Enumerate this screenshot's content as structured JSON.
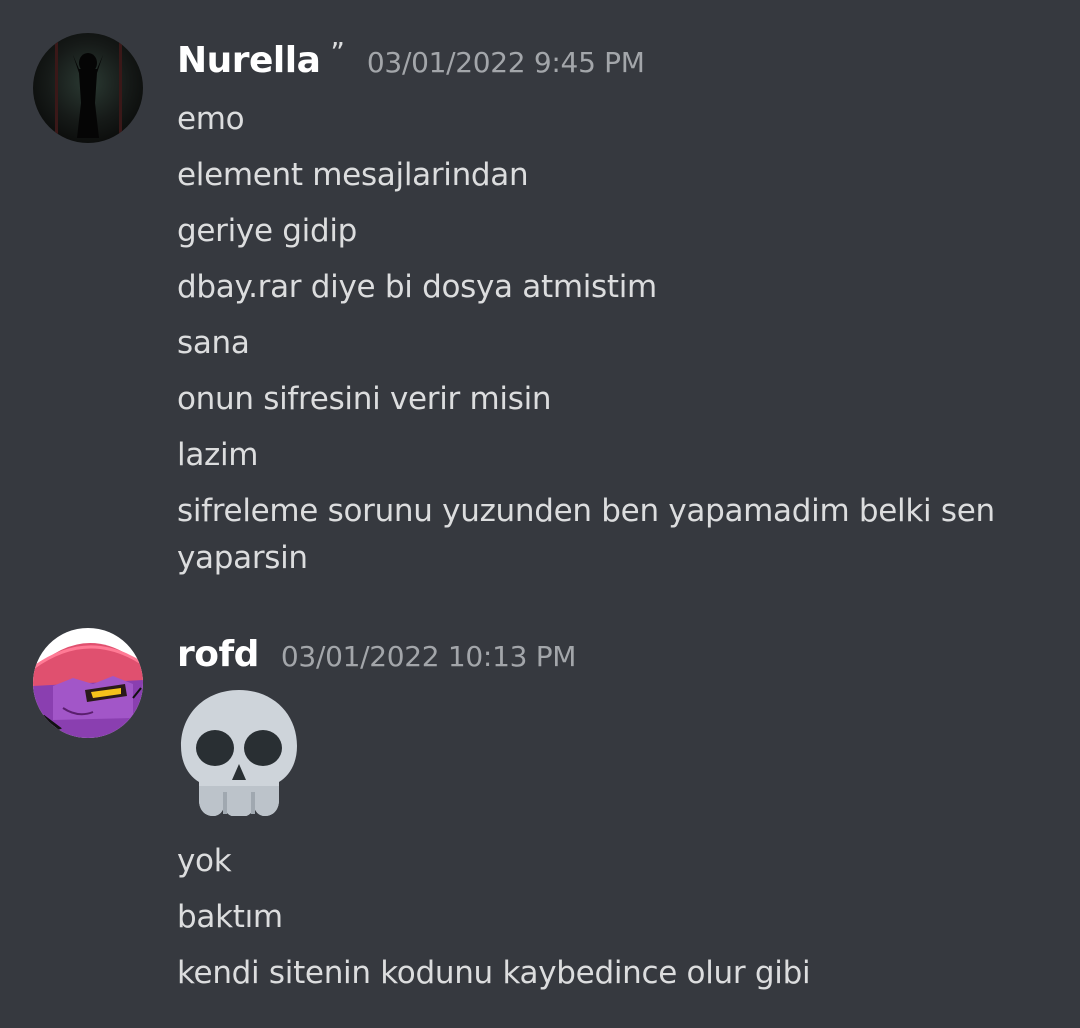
{
  "messages": [
    {
      "username": "Nurella",
      "badge": "”",
      "timestamp": "03/01/2022 9:45 PM",
      "avatar_icon": "user-avatar-dark-figure",
      "lines": [
        "emo",
        "element mesajlarindan",
        "geriye gidip",
        "dbay.rar diye bi dosya atmistim",
        "sana",
        "onun sifresini verir misin",
        "lazim",
        "sifreleme sorunu yuzunden ben yapamadim belki sen yaparsin"
      ]
    },
    {
      "username": "rofd",
      "timestamp": "03/01/2022 10:13 PM",
      "avatar_icon": "user-avatar-purple-cat-character",
      "emoji": "skull-emoji",
      "lines": [
        "yok",
        "baktım",
        "kendi sitenin kodunu kaybedince olur gibi"
      ]
    }
  ],
  "colors": {
    "background": "#36393f",
    "username": "#ffffff",
    "text": "#dcddde",
    "timestamp": "#a3a6aa",
    "avatar_ring": "#ff5c7a"
  }
}
